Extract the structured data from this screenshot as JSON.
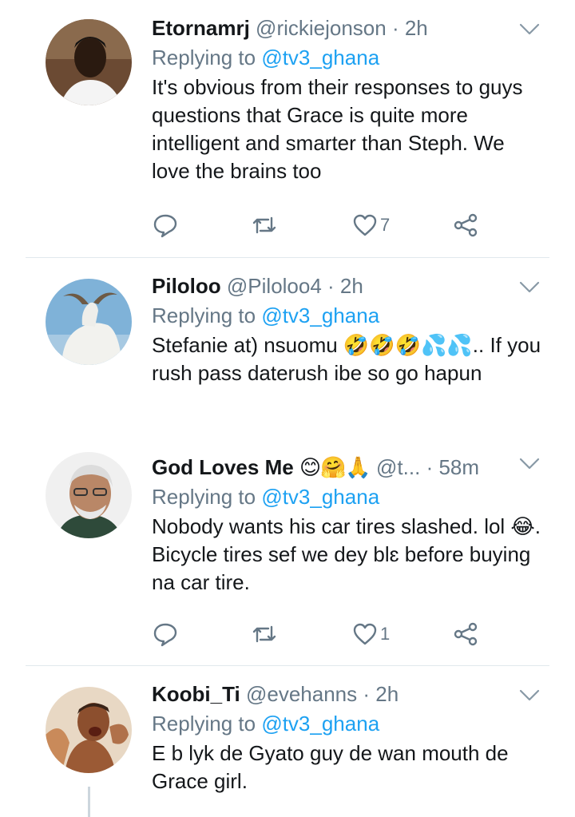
{
  "replying_label": "Replying to",
  "tweets": [
    {
      "name": "Etornamrj",
      "handle": "@rickiejonson",
      "time": "· 2h",
      "reply_to": "@tv3_ghana",
      "text": "It's obvious from their responses to guys questions that Grace is quite more intelligent and smarter than Steph. We love the brains too",
      "like_count": "7"
    },
    {
      "name": "Piloloo",
      "handle": "@Piloloo4",
      "time": "· 2h",
      "reply_to": "@tv3_ghana",
      "text": "Stefanie at) nsuomu 🤣🤣🤣💦💦.. If you rush pass daterush ibe so go hapun"
    },
    {
      "name": "God Loves Me",
      "name_emojis": "😊🤗🙏",
      "handle": "@t...",
      "time": "· 58m",
      "reply_to": "@tv3_ghana",
      "text": "Nobody wants his car tires slashed. lol 😂. Bicycle tires sef we dey blɛ before buying na car tire.",
      "like_count": "1"
    },
    {
      "name": "Koobi_Ti",
      "handle": "@evehanns",
      "time": "· 2h",
      "reply_to": "@tv3_ghana",
      "text": "E b lyk de Gyato guy de wan mouth de Grace girl."
    }
  ]
}
